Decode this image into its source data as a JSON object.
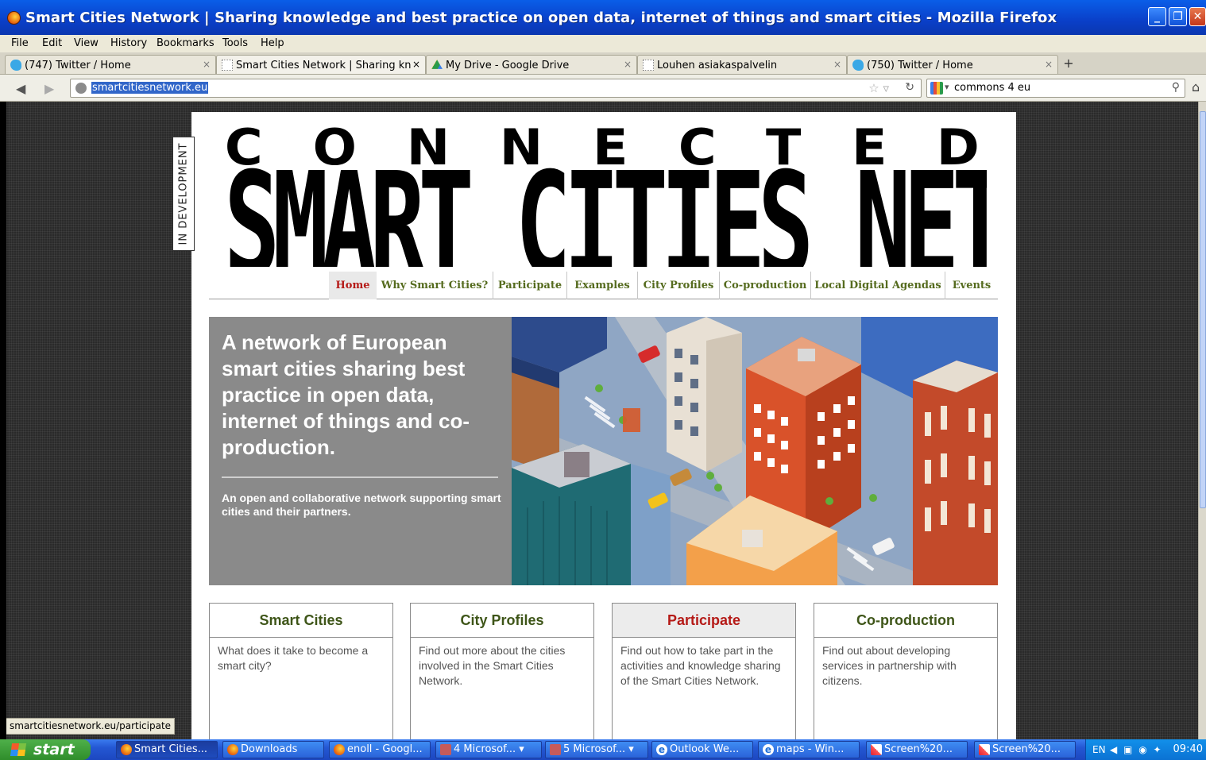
{
  "window": {
    "title": "Smart Cities Network | Sharing knowledge and best practice on open data, internet of things and smart cities - Mozilla Firefox"
  },
  "menu": [
    "File",
    "Edit",
    "View",
    "History",
    "Bookmarks",
    "Tools",
    "Help"
  ],
  "tabs": [
    {
      "label": "(747) Twitter / Home",
      "icon": "twitter-icon",
      "active": false
    },
    {
      "label": "Smart Cities Network | Sharing kn...",
      "icon": "blank-page-icon",
      "active": true
    },
    {
      "label": "My Drive - Google Drive",
      "icon": "google-drive-icon",
      "active": false
    },
    {
      "label": "Louhen asiakaspalvelin",
      "icon": "blank-page-icon",
      "active": false
    },
    {
      "label": "(750) Twitter / Home",
      "icon": "twitter-icon",
      "active": false
    }
  ],
  "nav_bar": {
    "url": "smartcitiesnetwork.eu",
    "search_value": "commons 4 eu"
  },
  "page": {
    "dev_badge": "IN DEVELOPMENT",
    "logo_top": [
      "C",
      "O",
      "N",
      "N",
      "E",
      "C",
      "T",
      "E",
      "D"
    ],
    "logo_main": "SMART CITIES NETWORK",
    "nav": [
      "Home",
      "Why Smart Cities?",
      "Participate",
      "Examples",
      "City Profiles",
      "Co-production",
      "Local Digital Agendas",
      "Events"
    ],
    "hero": {
      "title": "A network of European smart cities sharing best practice in open data, internet of things and co-production.",
      "subtitle": "An open and collaborative network supporting smart cities and their partners."
    },
    "cards": [
      {
        "title": "Smart Cities",
        "text": "What does it take to become a smart city?",
        "highlighted": false
      },
      {
        "title": "City Profiles",
        "text": "Find out more about the cities involved in the Smart Cities Network.",
        "highlighted": false
      },
      {
        "title": "Participate",
        "text": "Find out how to take part in the activities and knowledge sharing of the Smart Cities Network.",
        "highlighted": true
      },
      {
        "title": "Co-production",
        "text": "Find out about developing services in partnership with citizens.",
        "highlighted": false
      }
    ]
  },
  "status_bar": "smartcitiesnetwork.eu/participate",
  "taskbar": {
    "start_label": "start",
    "items": [
      "Smart Cities...",
      "Downloads",
      "enoll - Googl...",
      "4 Microsof...",
      "5 Microsof...",
      "Outlook We...",
      "maps - Win...",
      "Screen%20...",
      "Screen%20..."
    ],
    "tray_lang": "EN",
    "clock": "09:40"
  },
  "colors": {
    "nav_text": "#556b1e",
    "nav_active": "#b51a17",
    "card_title": "#3e5518",
    "hero_panel": "#8a8a8a"
  }
}
